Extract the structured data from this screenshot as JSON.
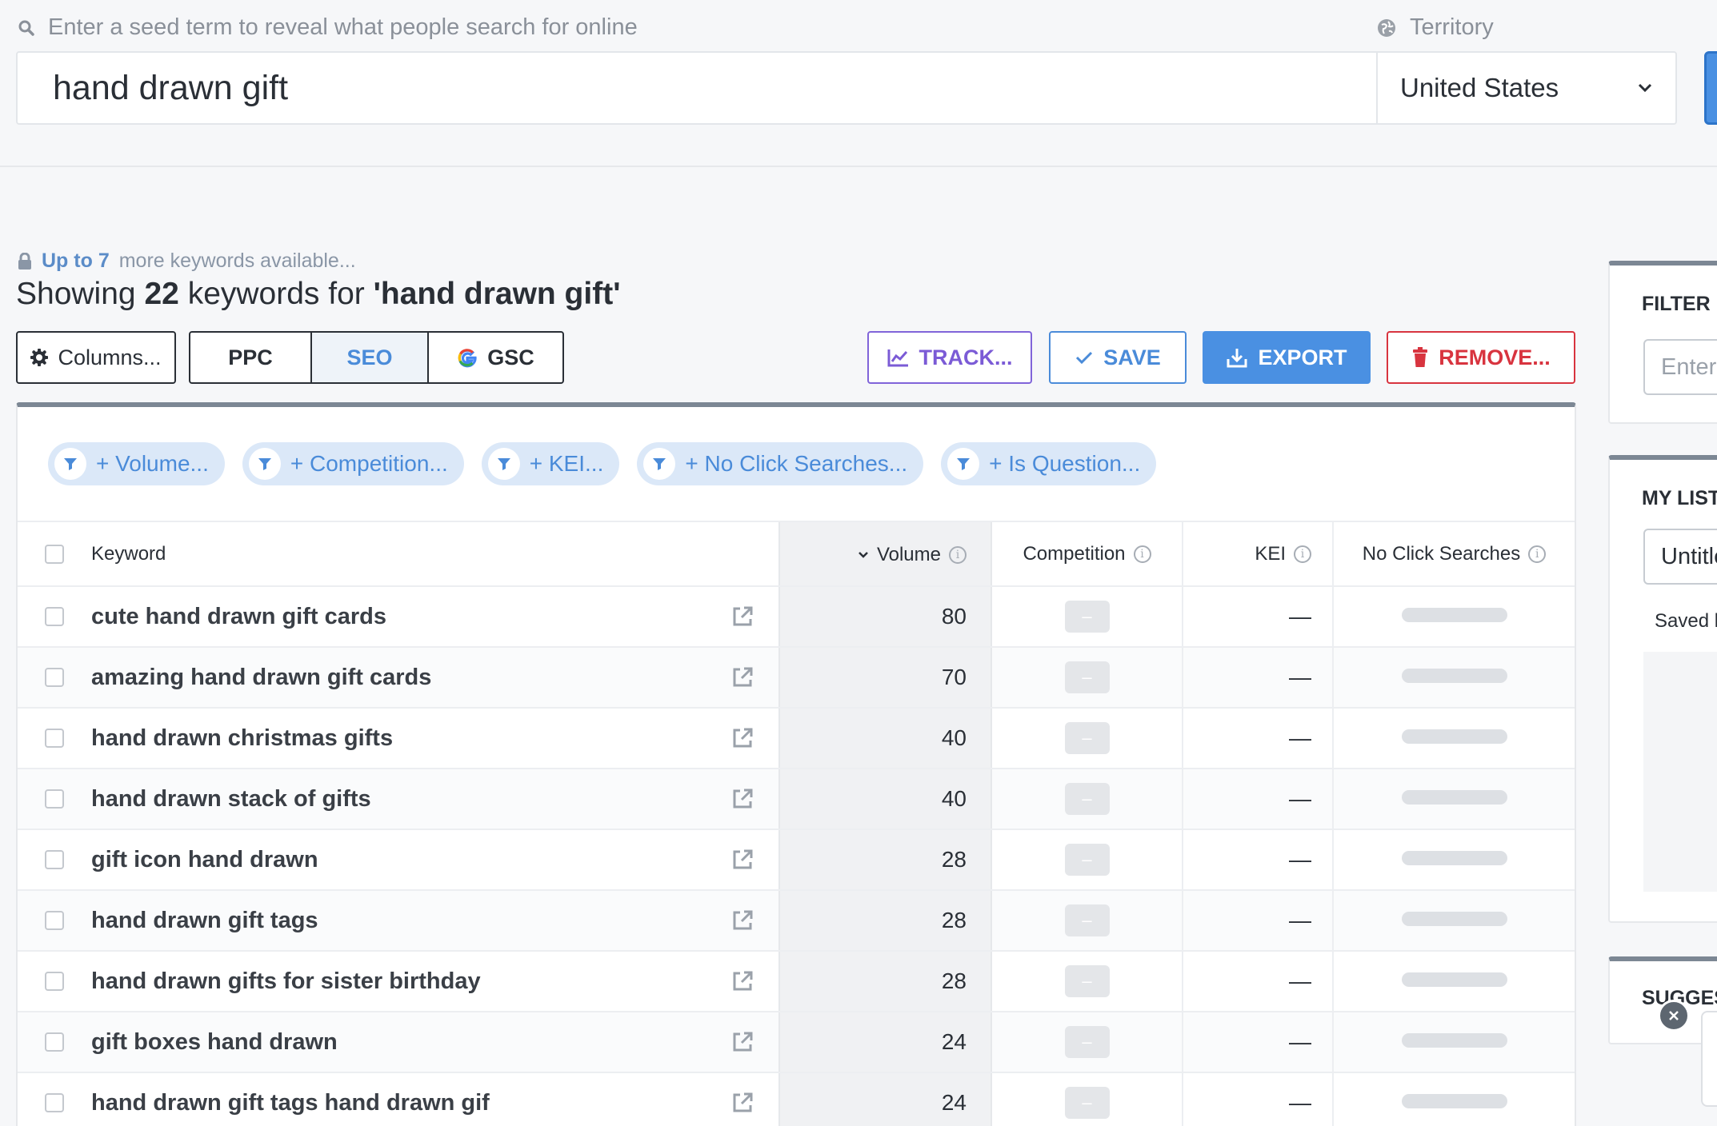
{
  "search": {
    "hint": "Enter a seed term to reveal what people search for online",
    "value": "hand drawn gift",
    "territory_label": "Territory",
    "territory_value": "United States"
  },
  "header": {
    "upsell_bold": "Up to 7",
    "upsell_rest": "more keywords available...",
    "showing_prefix": "Showing",
    "count": "22",
    "showing_mid": "keywords for",
    "query": "'hand drawn gift'"
  },
  "toolbar": {
    "columns": "Columns...",
    "ppc": "PPC",
    "seo": "SEO",
    "gsc": "GSC",
    "track": "TRACK...",
    "save": "SAVE",
    "export": "EXPORT",
    "remove": "REMOVE..."
  },
  "filters": [
    "+ Volume...",
    "+ Competition...",
    "+ KEI...",
    "+ No Click Searches...",
    "+ Is Question..."
  ],
  "table": {
    "columns": {
      "keyword": "Keyword",
      "volume": "Volume",
      "competition": "Competition",
      "kei": "KEI",
      "ncs": "No Click Searches"
    },
    "rows": [
      {
        "keyword": "cute hand drawn gift cards",
        "volume": "80",
        "competition": "–",
        "kei": "—"
      },
      {
        "keyword": "amazing hand drawn gift cards",
        "volume": "70",
        "competition": "–",
        "kei": "—"
      },
      {
        "keyword": "hand drawn christmas gifts",
        "volume": "40",
        "competition": "–",
        "kei": "—"
      },
      {
        "keyword": "hand drawn stack of gifts",
        "volume": "40",
        "competition": "–",
        "kei": "—"
      },
      {
        "keyword": "gift icon hand drawn",
        "volume": "28",
        "competition": "–",
        "kei": "—"
      },
      {
        "keyword": "hand drawn gift tags",
        "volume": "28",
        "competition": "–",
        "kei": "—"
      },
      {
        "keyword": "hand drawn gifts for sister birthday",
        "volume": "28",
        "competition": "–",
        "kei": "—"
      },
      {
        "keyword": "gift boxes hand drawn",
        "volume": "24",
        "competition": "–",
        "kei": "—"
      },
      {
        "keyword": "hand drawn gift tags hand drawn gif",
        "volume": "24",
        "competition": "–",
        "kei": "—"
      }
    ]
  },
  "right": {
    "filter_title": "FILTER R",
    "filter_placeholder": "Enter",
    "list_title": "MY LIST",
    "list_input": "Untitle",
    "saved": "Saved k",
    "sugg_title": "SUGGES"
  },
  "colors": {
    "accent": "#4a90e2",
    "track": "#7b5bd6",
    "remove": "#d8343f",
    "chip_bg": "#dbe8f8"
  }
}
